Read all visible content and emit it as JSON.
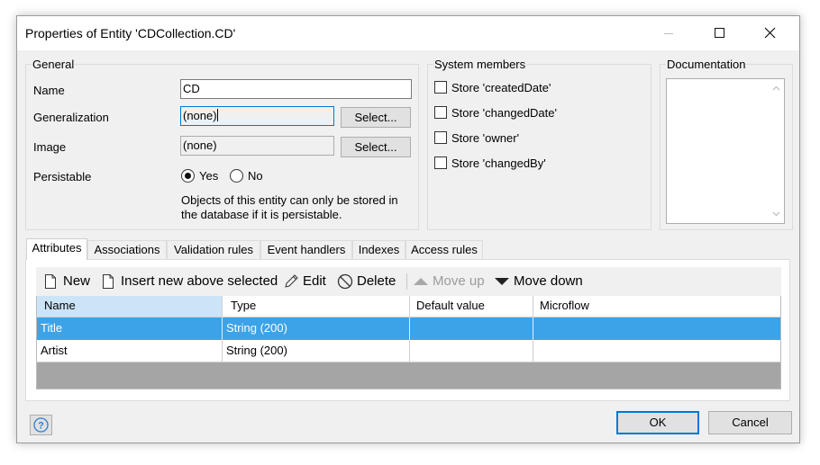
{
  "window": {
    "title": "Properties of Entity 'CDCollection.CD'"
  },
  "general": {
    "group_title": "General",
    "name_label": "Name",
    "name_value": "CD",
    "generalization_label": "Generalization",
    "generalization_value": "(none)",
    "image_label": "Image",
    "image_value": "(none)",
    "select_label": "Select...",
    "persistable_label": "Persistable",
    "yes_label": "Yes",
    "no_label": "No",
    "persistable_selected": "Yes",
    "note_line1": "Objects of this entity can only be stored in",
    "note_line2": "the database if it is persistable."
  },
  "system_members": {
    "group_title": "System members",
    "items": [
      {
        "label": "Store 'createdDate'",
        "checked": false
      },
      {
        "label": "Store 'changedDate'",
        "checked": false
      },
      {
        "label": "Store 'owner'",
        "checked": false
      },
      {
        "label": "Store 'changedBy'",
        "checked": false
      }
    ]
  },
  "documentation": {
    "group_title": "Documentation",
    "text": ""
  },
  "tabs": [
    {
      "label": "Attributes",
      "active": true
    },
    {
      "label": "Associations",
      "active": false
    },
    {
      "label": "Validation rules",
      "active": false
    },
    {
      "label": "Event handlers",
      "active": false
    },
    {
      "label": "Indexes",
      "active": false
    },
    {
      "label": "Access rules",
      "active": false
    }
  ],
  "toolbar": {
    "new_label": "New",
    "insert_label": "Insert new above selected",
    "edit_label": "Edit",
    "delete_label": "Delete",
    "move_up_label": "Move up",
    "move_down_label": "Move down"
  },
  "grid": {
    "columns": [
      "Name",
      "Type",
      "Default value",
      "Microflow"
    ],
    "rows": [
      {
        "name": "Title",
        "type": "String (200)",
        "default": "",
        "microflow": ""
      },
      {
        "name": "Artist",
        "type": "String (200)",
        "default": "",
        "microflow": ""
      }
    ]
  },
  "footer": {
    "ok_label": "OK",
    "cancel_label": "Cancel"
  },
  "colors": {
    "selection": "#3ca3e8",
    "focus_border": "#0078d7",
    "dialog_bg": "#f0f0f0"
  }
}
